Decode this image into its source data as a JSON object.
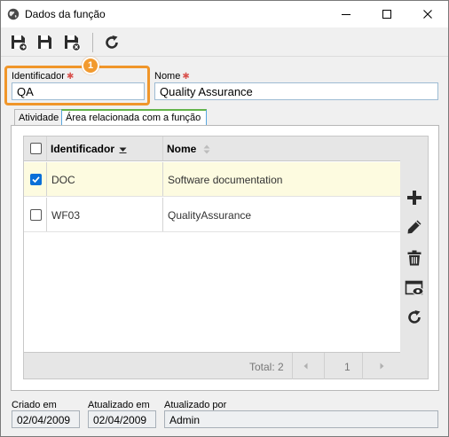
{
  "window": {
    "title": "Dados da função"
  },
  "toolbar": {
    "buttons": [
      {
        "icon": "save-new-icon"
      },
      {
        "icon": "save-icon"
      },
      {
        "icon": "save-close-icon"
      },
      {
        "icon": "refresh-icon"
      }
    ]
  },
  "form": {
    "identificador_label": "Identificador",
    "identificador_value": "QA",
    "nome_label": "Nome",
    "nome_value": "Quality Assurance",
    "required_mark": "✱"
  },
  "annotation": {
    "badge": "1",
    "color": "#f0962a"
  },
  "tabs": [
    {
      "label": "Atividade",
      "active": false
    },
    {
      "label": "Área relacionada com a função",
      "active": true
    }
  ],
  "grid": {
    "columns": [
      {
        "label": "Identificador",
        "sort": "descending"
      },
      {
        "label": "Nome",
        "sort": "none"
      }
    ],
    "rows": [
      {
        "id": "DOC",
        "name": "Software documentation",
        "checked": true
      },
      {
        "id": "WF03",
        "name": "QualityAssurance",
        "checked": false
      }
    ],
    "footer": {
      "total": "Total: 2",
      "page": "1"
    }
  },
  "side_actions": [
    {
      "icon": "add-icon"
    },
    {
      "icon": "edit-icon"
    },
    {
      "icon": "delete-icon"
    },
    {
      "icon": "view-icon"
    },
    {
      "icon": "refresh-icon"
    }
  ],
  "footer": {
    "criado_em_label": "Criado em",
    "criado_em_value": "02/04/2009",
    "atualizado_em_label": "Atualizado em",
    "atualizado_em_value": "02/04/2009",
    "atualizado_por_label": "Atualizado por",
    "atualizado_por_value": "Admin"
  },
  "colors": {
    "accent": "#0a6fd8",
    "selected_row": "#fdfbe0",
    "required": "#d9534f",
    "tab_active": "#63b34a"
  }
}
